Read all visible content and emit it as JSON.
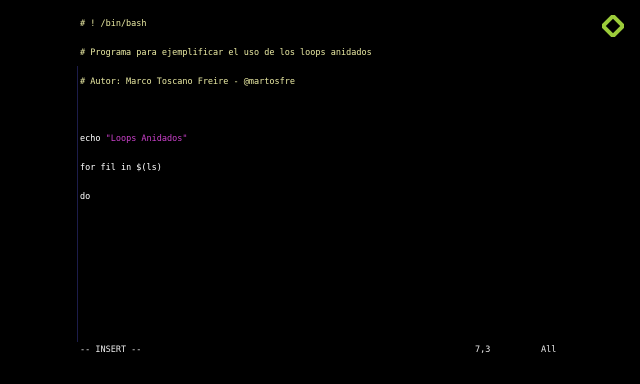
{
  "buffer": {
    "lines": [
      {
        "kind": "comment",
        "text": "# ! /bin/bash"
      },
      {
        "kind": "comment",
        "text": "# Programa para ejemplificar el uso de los loops anidados"
      },
      {
        "kind": "comment",
        "text": "# Autor: Marco Toscano Freire - @martosfre"
      },
      {
        "kind": "blank",
        "text": ""
      },
      {
        "kind": "code",
        "keyword": "echo",
        "string": "\"Loops Anidados\""
      },
      {
        "kind": "code",
        "keyword": "for",
        "rest": "fil in $(ls)"
      },
      {
        "kind": "code",
        "keyword": "do",
        "rest": ""
      }
    ]
  },
  "statusline": {
    "mode": "-- INSERT --",
    "position": "7,3",
    "scroll": "All"
  },
  "colors": {
    "background": "#000000",
    "comment": "#e6e6a0",
    "string": "#c940c9",
    "text": "#e8e8e8",
    "logo": "#9ccc3a"
  },
  "logo": {
    "icon": "platzi-logo-icon"
  }
}
